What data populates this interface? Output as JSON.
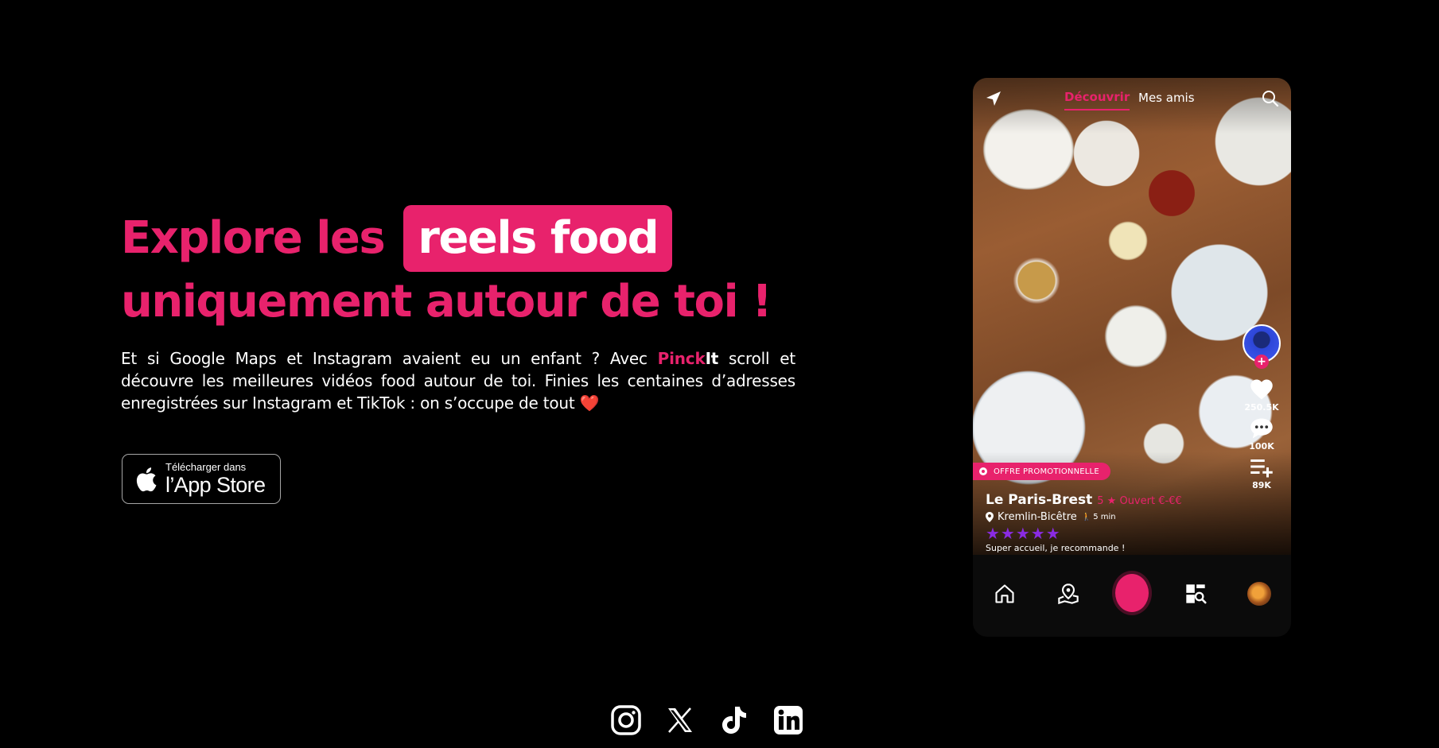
{
  "hero": {
    "title_part1": "Explore les",
    "title_highlight": "reels food",
    "title_line2": "uniquement autour de toi !",
    "desc_before": "Et si Google Maps et Instagram avaient eu un enfant ? Avec ",
    "brand_pink": "Pinck",
    "brand_white": "It",
    "desc_after": " scroll  et découvre les meilleures vidéos food autour de toi. Finies les centaines d’adresses enregistrées sur Instagram et TikTok : on s’occupe de tout ",
    "heart": "❤️"
  },
  "appstore": {
    "small": "Télécharger dans",
    "big": "l’App Store",
    "icon": "apple-icon"
  },
  "phone": {
    "tabs": {
      "discover": "Découvrir",
      "friends": "Mes amis"
    },
    "actions": {
      "likes": "250.5K",
      "comments": "100K",
      "saves": "89K"
    },
    "promo": "OFFRE PROMOTIONNELLE",
    "place": {
      "name": "Le Paris-Brest",
      "meta": "5 ★  Ouvert  €-€€",
      "location": "Kremlin-Bicêtre",
      "walk": "5 min",
      "stars": "★★★★★",
      "review": "Super accueil, je recommande !"
    },
    "accent": "#e8226c",
    "star_color": "#8a2be2"
  },
  "socials": [
    "instagram-icon",
    "x-icon",
    "tiktok-icon",
    "linkedin-icon"
  ]
}
